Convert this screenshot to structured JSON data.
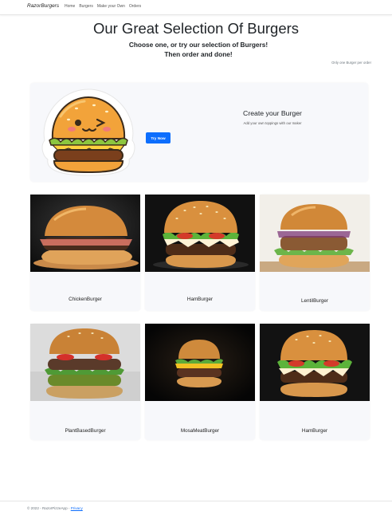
{
  "nav": {
    "brand": "RazorBurgers",
    "links": [
      "Home",
      "Burgers",
      "Make your Own",
      "Orders"
    ]
  },
  "header": {
    "title": "Our Great Selection Of Burgers",
    "subtitle_line1": "Choose one, or try our selection of Burgers!",
    "subtitle_line2": "Then order and done!",
    "note": "Only one Burger per order"
  },
  "hero": {
    "title": "Create your Burger",
    "description": "Add your own toppings with our maker",
    "button_label": "Try Now"
  },
  "burgers": [
    {
      "name": "ChickenBurger"
    },
    {
      "name": "HamBurger"
    },
    {
      "name": "LentilBurger"
    },
    {
      "name": "PlantBasedBurger"
    },
    {
      "name": "MosaMeatBurger"
    },
    {
      "name": "HamBurger"
    }
  ],
  "footer": {
    "text": "© 2022 - RazorPizzeApp -",
    "privacy_link": "Privacy"
  },
  "colors": {
    "accent": "#0d6efd",
    "card_bg": "#f7f8fb"
  }
}
